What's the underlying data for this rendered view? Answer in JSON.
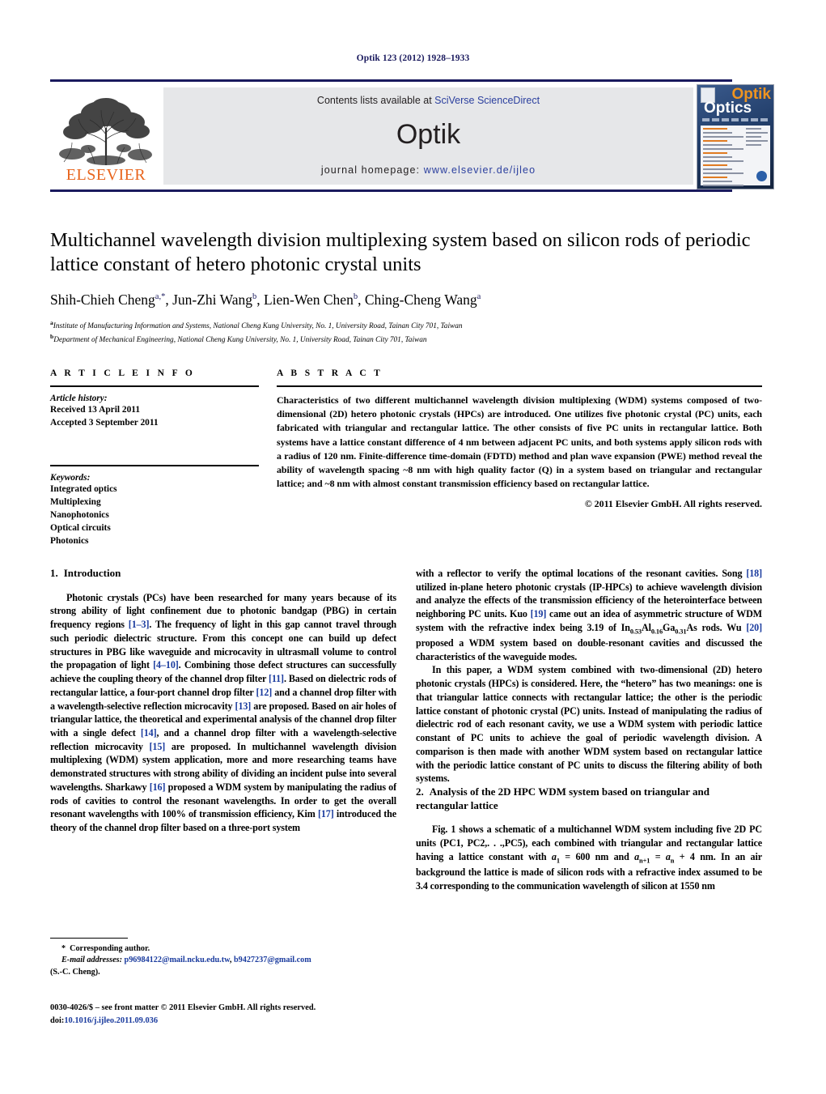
{
  "running_head": "Optik 123 (2012) 1928–1933",
  "masthead": {
    "contents_prefix": "Contents lists available at ",
    "contents_link": "SciVerse ScienceDirect",
    "journal_name": "Optik",
    "homepage_label": "journal homepage:",
    "homepage_url": "www.elsevier.de/ijleo",
    "publisher": "ELSEVIER",
    "cover": {
      "title_top": "Optik",
      "title_bottom": "Optics"
    },
    "colors": {
      "rule": "#1a1a5e",
      "link": "#2b3f9e",
      "elsevier_orange": "#e8641c",
      "panel": "#e6e7e9"
    }
  },
  "article": {
    "title": "Multichannel wavelength division multiplexing system based on silicon rods of periodic lattice constant of hetero photonic crystal units",
    "authors": [
      {
        "name": "Shih-Chieh Cheng",
        "sup": "a,*"
      },
      {
        "name": "Jun-Zhi Wang",
        "sup": "b"
      },
      {
        "name": "Lien-Wen Chen",
        "sup": "b"
      },
      {
        "name": "Ching-Cheng Wang",
        "sup": "a"
      }
    ],
    "affiliations": [
      {
        "marker": "a",
        "text": "Institute of Manufacturing Information and Systems, National Cheng Kung University, No. 1, University Road, Tainan City 701, Taiwan"
      },
      {
        "marker": "b",
        "text": "Department of Mechanical Engineering, National Cheng Kung University, No. 1, University Road, Tainan City 701, Taiwan"
      }
    ]
  },
  "article_info": {
    "heading": "A R T I C L E   I N F O",
    "history_label": "Article history:",
    "received": "Received 13 April 2011",
    "accepted": "Accepted 3 September 2011",
    "keywords_label": "Keywords:",
    "keywords": [
      "Integrated optics",
      "Multiplexing",
      "Nanophotonics",
      "Optical circuits",
      "Photonics"
    ]
  },
  "abstract": {
    "heading": "A B S T R A C T",
    "paragraphs": [
      "Characteristics of two different multichannel wavelength division multiplexing (WDM) systems composed of two-dimensional (2D) hetero photonic crystals (HPCs) are introduced. One utilizes five photonic crystal (PC) units, each fabricated with triangular and rectangular lattice. The other consists of five PC units in rectangular lattice. Both systems have a lattice constant difference of 4 nm between adjacent PC units, and both systems apply silicon rods with a radius of 120 nm. Finite-difference time-domain (FDTD) method and plan wave expansion (PWE) method reveal the ability of wavelength spacing ~8 nm with high quality factor (Q) in a system based on triangular and rectangular lattice; and ~8 nm with almost constant transmission efficiency based on rectangular lattice."
    ],
    "copyright": "© 2011 Elsevier GmbH. All rights reserved."
  },
  "sections": {
    "intro": {
      "number": "1.",
      "title": "Introduction",
      "p1_segments": [
        {
          "t": "Photonic crystals (PCs) have been researched for many years because of its strong ability of light confinement due to photonic bandgap (PBG) in certain frequency regions "
        },
        {
          "t": "[1–3]",
          "ref": true
        },
        {
          "t": ". The frequency of light in this gap cannot travel through such periodic dielectric structure. From this concept one can build up defect structures in PBG like waveguide and microcavity in ultrasmall volume to control the propagation of light "
        },
        {
          "t": "[4–10]",
          "ref": true
        },
        {
          "t": ". Combining those defect structures can successfully achieve the coupling theory of the channel drop filter "
        },
        {
          "t": "[11]",
          "ref": true
        },
        {
          "t": ". Based on dielectric rods of rectangular lattice, a four-port channel drop filter "
        },
        {
          "t": "[12]",
          "ref": true
        },
        {
          "t": " and a channel drop filter with a wavelength-selective reflection microcavity "
        },
        {
          "t": "[13]",
          "ref": true
        },
        {
          "t": " are proposed. Based on air holes of triangular lattice, the theoretical and experimental analysis of the channel drop filter with a single defect "
        },
        {
          "t": "[14]",
          "ref": true
        },
        {
          "t": ", and a channel drop filter with a wavelength-selective reflection microcavity "
        },
        {
          "t": "[15]",
          "ref": true
        },
        {
          "t": " are proposed. In multichannel wavelength division multiplexing (WDM) system application, more and more researching teams have demonstrated structures with strong ability of dividing an incident pulse into several wavelengths. Sharkawy "
        },
        {
          "t": "[16]",
          "ref": true
        },
        {
          "t": " proposed a WDM system by manipulating the radius of rods of cavities to control the resonant wavelengths. In order to get the overall resonant wavelengths with 100% of transmission efficiency, Kim "
        },
        {
          "t": "[17]",
          "ref": true
        },
        {
          "t": " introduced the theory of the channel drop filter based on a three-port system with a reflector to verify the optimal locations of the resonant cavities. Song "
        },
        {
          "t": "[18]",
          "ref": true
        },
        {
          "t": " utilized in-plane hetero photonic crystals (IP-HPCs) to achieve wavelength division and analyze the effects of the transmission efficiency of the heterointerface between neighboring PC units. Kuo "
        },
        {
          "t": "[19]",
          "ref": true
        },
        {
          "t": " came out an idea of asymmetric structure of WDM system with the refractive index being 3.19 of In"
        },
        {
          "t": "0.53",
          "sub": true
        },
        {
          "t": "Al"
        },
        {
          "t": "0.16",
          "sub": true
        },
        {
          "t": "Ga"
        },
        {
          "t": "0.31",
          "sub": true
        },
        {
          "t": "As rods. Wu "
        },
        {
          "t": "[20]",
          "ref": true
        },
        {
          "t": " proposed a WDM system based on double-resonant cavities and discussed the characteristics of the waveguide modes."
        }
      ],
      "p2": "In this paper, a WDM system combined with two-dimensional (2D) hetero photonic crystals (HPCs) is considered. Here, the “hetero” has two meanings: one is that triangular lattice connects with rectangular lattice; the other is the periodic lattice constant of photonic crystal (PC) units. Instead of manipulating the radius of dielectric rod of each resonant cavity, we use a WDM system with periodic lattice constant of PC units to achieve the goal of periodic wavelength division. A comparison is then made with another WDM system based on rectangular lattice with the periodic lattice constant of PC units to discuss the filtering ability of both systems."
    },
    "analysis": {
      "number": "2.",
      "title": "Analysis of the 2D HPC WDM system based on triangular and rectangular lattice",
      "p1_segments": [
        {
          "t": "Fig. 1",
          "bold": true
        },
        {
          "t": " shows a schematic of a multichannel WDM system including five 2D PC units (PC1, PC2,. . .,PC5), each combined with triangular and rectangular lattice having a lattice constant with "
        },
        {
          "t": "a",
          "math": true
        },
        {
          "t": "1",
          "sub": true
        },
        {
          "t": " = 600 nm and "
        },
        {
          "t": "a",
          "math": true
        },
        {
          "t": "n+1",
          "sub": true
        },
        {
          "t": " = "
        },
        {
          "t": "a",
          "math": true
        },
        {
          "t": "n",
          "sub": true
        },
        {
          "t": " + 4 nm. In an air background the lattice is made of silicon rods with a refractive index assumed to be 3.4 corresponding to the communication wavelength of silicon at 1550 nm"
        }
      ]
    }
  },
  "footnotes": {
    "corresponding": "Corresponding author.",
    "star": "*",
    "email_label": "E-mail addresses:",
    "emails": [
      "p96984122@mail.ncku.edu.tw",
      "b9427237@gmail.com"
    ],
    "email_owner": "(S.-C. Cheng)."
  },
  "imprint": {
    "line1": "0030-4026/$ – see front matter © 2011 Elsevier GmbH. All rights reserved.",
    "doi_label": "doi:",
    "doi": "10.1016/j.ijleo.2011.09.036"
  }
}
